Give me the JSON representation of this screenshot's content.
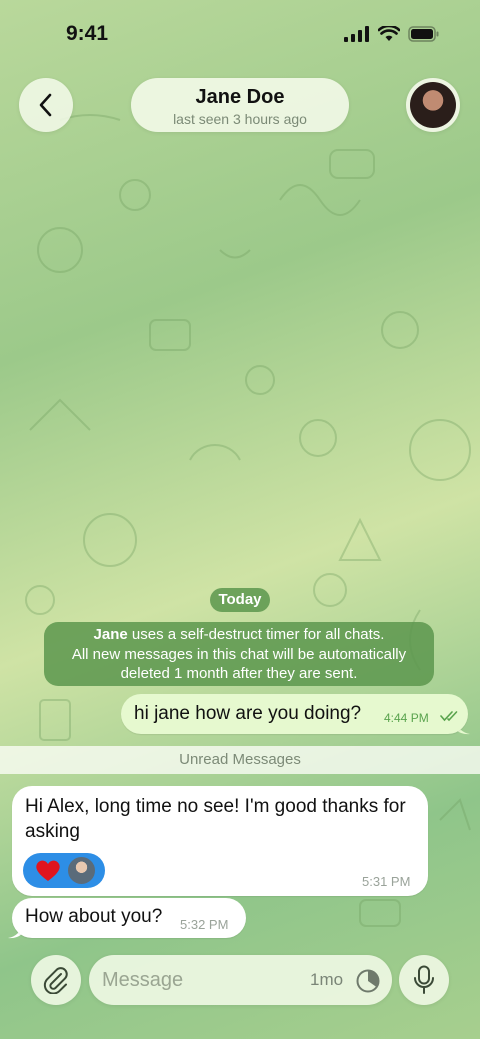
{
  "status_bar": {
    "time": "9:41"
  },
  "header": {
    "name": "Jane Doe",
    "last_seen": "last seen 3 hours ago"
  },
  "messages": {
    "date_chip": "Today",
    "service": {
      "name": "Jane",
      "text_1": " uses a self-destruct timer for all chats.",
      "text_2": "All new messages in this chat will be automatically",
      "text_3": "deleted 1 month after they are sent."
    },
    "outgoing": [
      {
        "text": "hi jane how are you doing?",
        "time": "4:44 PM",
        "status": "read"
      }
    ],
    "unread_label": "Unread Messages",
    "incoming": [
      {
        "text": "Hi Alex, long time no see! I'm good thanks for asking",
        "time": "5:31 PM",
        "reaction": "heart"
      },
      {
        "text": "How about you?",
        "time": "5:32 PM"
      }
    ]
  },
  "composer": {
    "placeholder": "Message",
    "timer": "1mo"
  },
  "colors": {
    "outgoing_bubble": "#e6f9cf",
    "incoming_bubble": "#ffffff",
    "service_chip": "#5c964e",
    "reaction_bg": "#2d8ee6",
    "read_check": "#59a34d"
  },
  "icons": {
    "back": "chevron-left-icon",
    "attach": "paperclip-icon",
    "timer": "timer-icon",
    "mic": "microphone-icon",
    "reaction": "heart-icon"
  }
}
